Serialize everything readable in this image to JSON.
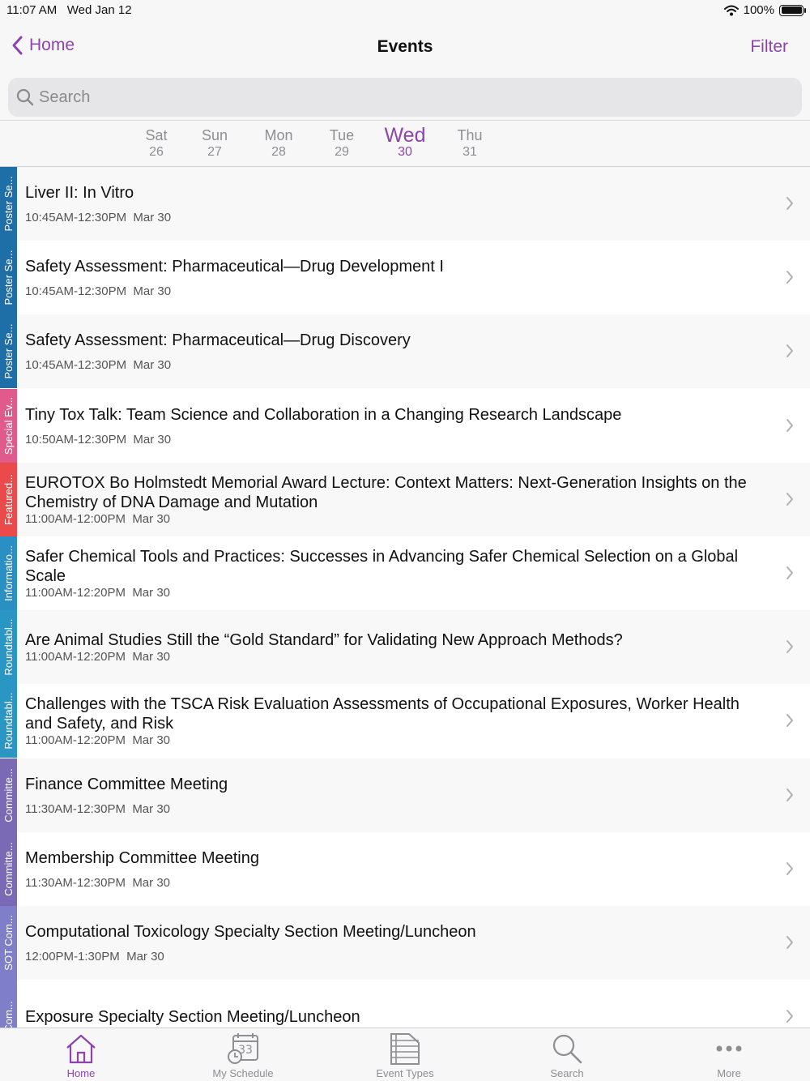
{
  "status_bar": {
    "time": "11:07 AM",
    "date": "Wed Jan 12",
    "battery": "100%"
  },
  "nav": {
    "back_label": "Home",
    "title": "Events",
    "filter_label": "Filter"
  },
  "search": {
    "placeholder": "Search"
  },
  "days": [
    {
      "name": "Sat",
      "num": "26",
      "active": false
    },
    {
      "name": "Sun",
      "num": "27",
      "active": false
    },
    {
      "name": "Mon",
      "num": "28",
      "active": false
    },
    {
      "name": "Tue",
      "num": "29",
      "active": false
    },
    {
      "name": "Wed",
      "num": "30",
      "active": true
    },
    {
      "name": "Thu",
      "num": "31",
      "active": false
    }
  ],
  "events": [
    {
      "category": "Poster Se...",
      "category_color": "#1e6fa8",
      "title": "Liver II: In Vitro",
      "time": "10:45AM-12:30PM",
      "date": "Mar 30"
    },
    {
      "category": "Poster Se...",
      "category_color": "#1e6fa8",
      "title": "Safety Assessment: Pharmaceutical—Drug Development I",
      "time": "10:45AM-12:30PM",
      "date": "Mar 30"
    },
    {
      "category": "Poster Se...",
      "category_color": "#1e6fa8",
      "title": "Safety Assessment: Pharmaceutical—Drug Discovery",
      "time": "10:45AM-12:30PM",
      "date": "Mar 30"
    },
    {
      "category": "Special Ev...",
      "category_color": "#e15a8c",
      "title": "Tiny Tox Talk: Team Science and Collaboration in a Changing Research Landscape",
      "time": "10:50AM-12:30PM",
      "date": "Mar 30"
    },
    {
      "category": "Featured...",
      "category_color": "#ea4a4a",
      "title": "EUROTOX Bo Holmstedt Memorial Award Lecture: Context Matters: Next-Generation Insights on the Chemistry of DNA Damage and Mutation",
      "time": "11:00AM-12:00PM",
      "date": "Mar 30"
    },
    {
      "category": "Informatio...",
      "category_color": "#2a8fc2",
      "title": "Safer Chemical Tools and Practices: Successes in Advancing Safer Chemical Selection on a Global Scale",
      "time": "11:00AM-12:20PM",
      "date": "Mar 30"
    },
    {
      "category": "Roundtabl...",
      "category_color": "#2a96c4",
      "title": "Are Animal Studies Still the “Gold Standard” for Validating New Approach Methods?",
      "time": "11:00AM-12:20PM",
      "date": "Mar 30"
    },
    {
      "category": "Roundtabl...",
      "category_color": "#2a96c4",
      "title": "Challenges with the TSCA Risk Evaluation Assessments of Occupational Exposures, Worker Health and Safety, and Risk",
      "time": "11:00AM-12:20PM",
      "date": "Mar 30"
    },
    {
      "category": "Committe...",
      "category_color": "#7a6ab5",
      "title": "Finance Committee Meeting",
      "time": "11:30AM-12:30PM",
      "date": "Mar 30"
    },
    {
      "category": "Committe...",
      "category_color": "#7a6ab5",
      "title": "Membership Committee Meeting",
      "time": "11:30AM-12:30PM",
      "date": "Mar 30"
    },
    {
      "category": "SOT Com...",
      "category_color": "#7f7ec9",
      "title": "Computational Toxicology Specialty Section Meeting/Luncheon",
      "time": "12:00PM-1:30PM",
      "date": "Mar 30"
    },
    {
      "category": "Com...",
      "category_color": "#7f7ec9",
      "title": "Exposure Specialty Section Meeting/Luncheon",
      "time": "",
      "date": ""
    }
  ],
  "tabs": [
    {
      "label": "Home",
      "icon": "home-icon",
      "active": true
    },
    {
      "label": "My Schedule",
      "icon": "calendar-clock-icon",
      "active": false
    },
    {
      "label": "Event Types",
      "icon": "list-icon",
      "active": false
    },
    {
      "label": "Search",
      "icon": "search-icon",
      "active": false
    },
    {
      "label": "More",
      "icon": "more-dots-icon",
      "active": false
    }
  ],
  "colors": {
    "accent": "#8e44ad",
    "secondary_text": "#8e8e93"
  }
}
